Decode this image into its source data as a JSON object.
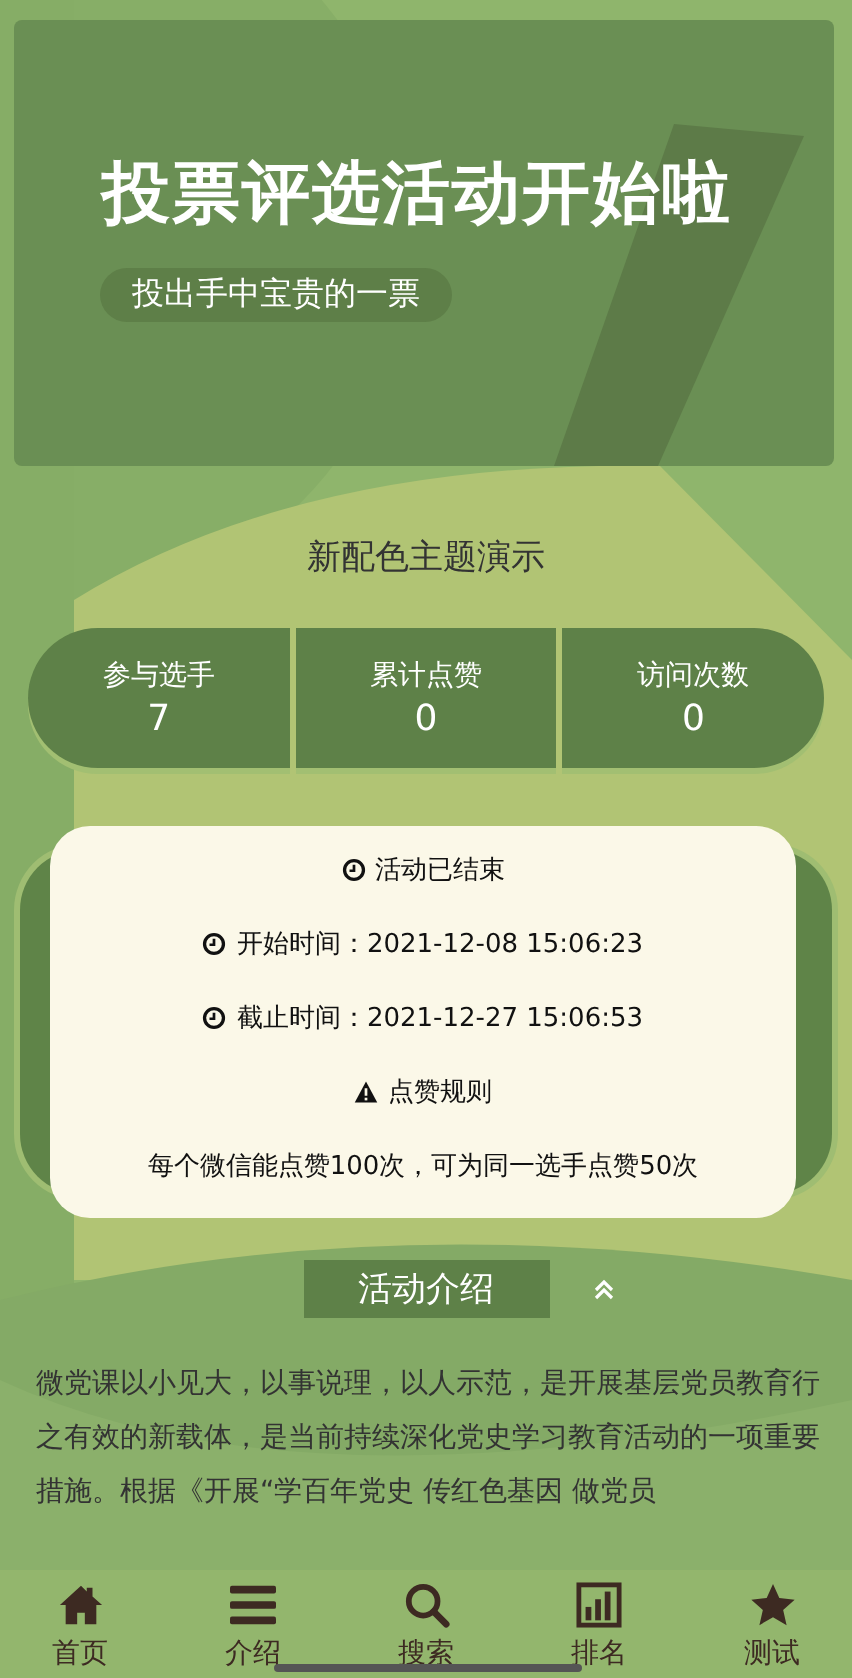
{
  "banner": {
    "title": "投票评选活动开始啦",
    "subtitle": "投出手中宝贵的一票"
  },
  "theme_heading": "新配色主题演示",
  "stats": [
    {
      "label": "参与选手",
      "value": "7"
    },
    {
      "label": "累计点赞",
      "value": "0"
    },
    {
      "label": "访问次数",
      "value": "0"
    }
  ],
  "info": [
    {
      "kind": "clock",
      "text": "活动已结束"
    },
    {
      "kind": "clock",
      "text": "开始时间：2021-12-08 15:06:23"
    },
    {
      "kind": "clock",
      "text": "截止时间：2021-12-27 15:06:53"
    },
    {
      "kind": "warning",
      "text": "点赞规则"
    },
    {
      "kind": "plain",
      "text": "每个微信能点赞100次，可为同一选手点赞50次"
    }
  ],
  "intro": {
    "title": "活动介绍",
    "paragraph": "微党课以小见大，以事说理，以人示范，是开展基层党员教育行之有效的新载体，是当前持续深化党史学习教育活动的一项重要措施。根据《开展“学百年党史 传红色基因 做党员"
  },
  "tab_bar": [
    {
      "kind": "home",
      "label": "首页"
    },
    {
      "kind": "menu",
      "label": "介绍"
    },
    {
      "kind": "search",
      "label": "搜索"
    },
    {
      "kind": "chart",
      "label": "排名"
    },
    {
      "kind": "star",
      "label": "测试"
    }
  ]
}
